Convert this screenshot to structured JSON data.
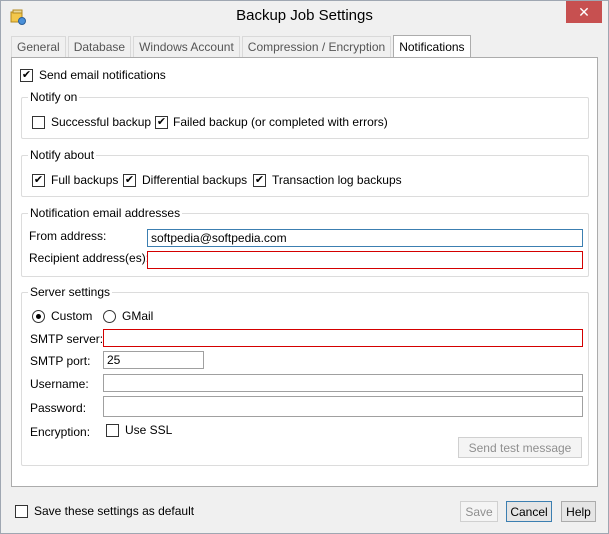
{
  "window": {
    "title": "Backup Job Settings",
    "close_label": "✕"
  },
  "tabs": [
    {
      "label": "General"
    },
    {
      "label": "Database"
    },
    {
      "label": "Windows Account"
    },
    {
      "label": "Compression / Encryption"
    },
    {
      "label": "Notifications",
      "active": true
    }
  ],
  "notifications": {
    "send_email_label": "Send email notifications",
    "send_email_checked": true,
    "notify_on": {
      "title": "Notify on",
      "successful_label": "Successful backup",
      "successful_checked": false,
      "failed_label": "Failed backup (or completed with errors)",
      "failed_checked": true
    },
    "notify_about": {
      "title": "Notify about",
      "full_label": "Full backups",
      "full_checked": true,
      "differential_label": "Differential backups",
      "differential_checked": true,
      "translog_label": "Transaction log backups",
      "translog_checked": true
    },
    "addresses": {
      "title": "Notification email addresses",
      "from_label": "From address:",
      "from_value": "softpedia@softpedia.com",
      "recipient_label": "Recipient address(es):",
      "recipient_value": ""
    },
    "server": {
      "title": "Server settings",
      "custom_label": "Custom",
      "gmail_label": "GMail",
      "selected": "Custom",
      "smtp_server_label": "SMTP server:",
      "smtp_server_value": "",
      "smtp_port_label": "SMTP port:",
      "smtp_port_value": "25",
      "username_label": "Username:",
      "username_value": "",
      "password_label": "Password:",
      "password_value": "",
      "encryption_label": "Encryption:",
      "ssl_label": "Use SSL",
      "ssl_checked": false,
      "send_test_label": "Send test message"
    },
    "error_mark": "!"
  },
  "footer": {
    "save_default_label": "Save these settings as default",
    "save_default_checked": false,
    "save_label": "Save",
    "cancel_label": "Cancel",
    "help_label": "Help"
  },
  "colors": {
    "error": "#d40000",
    "error_icon": "#ff5a00",
    "focus": "#3c7fb1",
    "close": "#c75050"
  }
}
